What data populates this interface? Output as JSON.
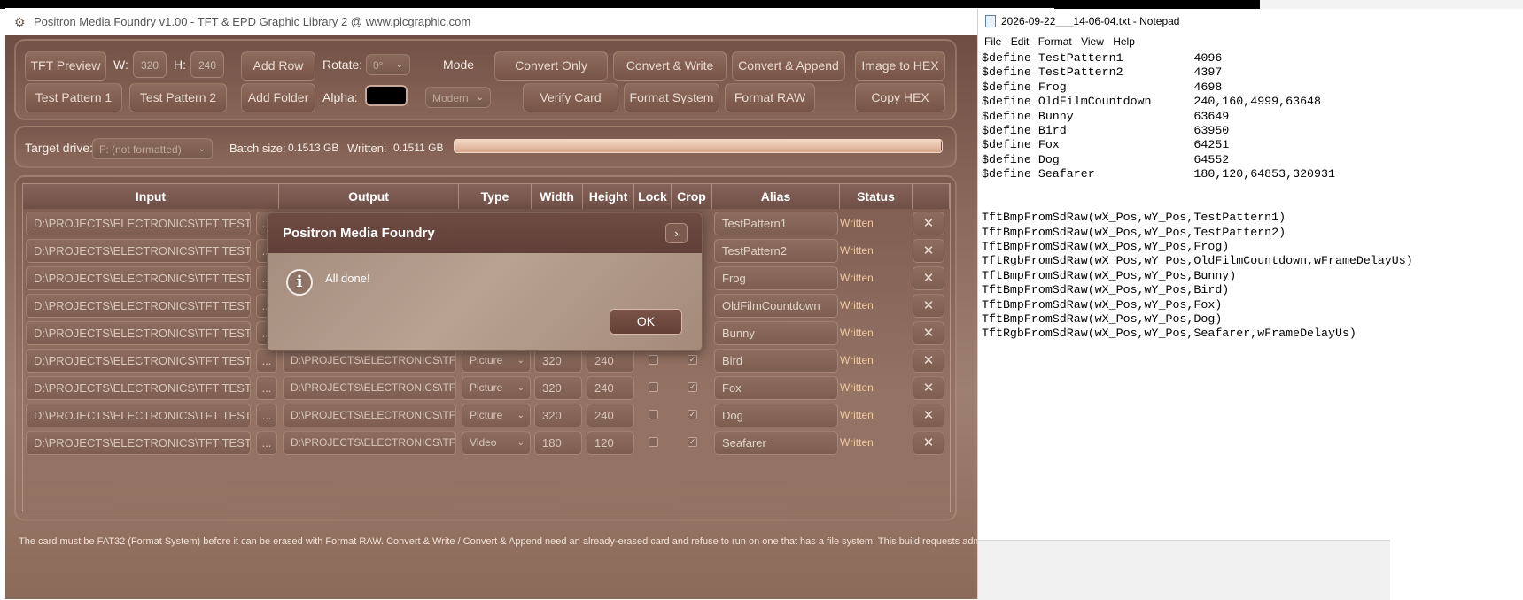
{
  "app": {
    "title": "Positron Media Foundry v1.00 - TFT & EPD Graphic Library 2 @ www.picgraphic.com",
    "toolbar": {
      "tft_preview": "TFT Preview",
      "w_label": "W:",
      "w_value": "320",
      "h_label": "H:",
      "h_value": "240",
      "add_row": "Add Row",
      "rotate_label": "Rotate:",
      "rotate_value": "0°",
      "mode_label": "Mode",
      "convert_only": "Convert Only",
      "convert_write": "Convert & Write",
      "convert_append": "Convert & Append",
      "image_to_hex": "Image to HEX",
      "test_pattern_1": "Test Pattern 1",
      "test_pattern_2": "Test Pattern 2",
      "add_folder": "Add Folder",
      "alpha_label": "Alpha:",
      "alpha_color": "#000000",
      "mode_value": "Modern",
      "verify_card": "Verify Card",
      "format_system": "Format System",
      "format_raw": "Format RAW",
      "copy_hex": "Copy HEX"
    },
    "drive": {
      "target_label": "Target drive:",
      "target_value": "F: (not formatted)",
      "batch_label": "Batch size:",
      "batch_value": "0.1513 GB",
      "written_label": "Written:",
      "written_value": "0.1511 GB",
      "progress_percent": 99.9
    },
    "grid": {
      "columns": [
        "Input",
        "Output",
        "Type",
        "Width",
        "Height",
        "Lock",
        "Crop",
        "Alias",
        "Status"
      ],
      "rows": [
        {
          "input": "D:\\PROJECTS\\ELECTRONICS\\TFT TEST BOARD\\",
          "output": "",
          "type": "",
          "width": "",
          "height": "",
          "lock": false,
          "crop": false,
          "alias": "TestPattern1",
          "status": "Written"
        },
        {
          "input": "D:\\PROJECTS\\ELECTRONICS\\TFT TEST BOARD\\",
          "output": "",
          "type": "",
          "width": "",
          "height": "",
          "lock": false,
          "crop": false,
          "alias": "TestPattern2",
          "status": "Written"
        },
        {
          "input": "D:\\PROJECTS\\ELECTRONICS\\TFT TEST BOARD\\",
          "output": "",
          "type": "",
          "width": "",
          "height": "",
          "lock": false,
          "crop": false,
          "alias": "Frog",
          "status": "Written"
        },
        {
          "input": "D:\\PROJECTS\\ELECTRONICS\\TFT TEST BOARD\\",
          "output": "",
          "type": "",
          "width": "",
          "height": "",
          "lock": false,
          "crop": false,
          "alias": "OldFilmCountdown",
          "status": "Written"
        },
        {
          "input": "D:\\PROJECTS\\ELECTRONICS\\TFT TEST BOARD\\",
          "output": "",
          "type": "",
          "width": "",
          "height": "",
          "lock": false,
          "crop": false,
          "alias": "Bunny",
          "status": "Written"
        },
        {
          "input": "D:\\PROJECTS\\ELECTRONICS\\TFT TEST BOARD\\",
          "output": "D:\\PROJECTS\\ELECTRONICS\\TFT TE",
          "type": "Picture",
          "width": "320",
          "height": "240",
          "lock": false,
          "crop": true,
          "alias": "Bird",
          "status": "Written"
        },
        {
          "input": "D:\\PROJECTS\\ELECTRONICS\\TFT TEST BOARD\\",
          "output": "D:\\PROJECTS\\ELECTRONICS\\TFT TE",
          "type": "Picture",
          "width": "320",
          "height": "240",
          "lock": false,
          "crop": true,
          "alias": "Fox",
          "status": "Written"
        },
        {
          "input": "D:\\PROJECTS\\ELECTRONICS\\TFT TEST BOARD\\",
          "output": "D:\\PROJECTS\\ELECTRONICS\\TFT TE",
          "type": "Picture",
          "width": "320",
          "height": "240",
          "lock": false,
          "crop": true,
          "alias": "Dog",
          "status": "Written"
        },
        {
          "input": "D:\\PROJECTS\\ELECTRONICS\\TFT TEST BOARD\\",
          "output": "D:\\PROJECTS\\ELECTRONICS\\TFT TE",
          "type": "Video",
          "width": "180",
          "height": "120",
          "lock": false,
          "crop": true,
          "alias": "Seafarer",
          "status": "Written"
        }
      ],
      "browse_label": "...",
      "remove_glyph": "✕"
    },
    "footer": "The card must be FAT32 (Format System) before it can be erased with Format RAW. Convert & Write / Convert & Append need an already-erased card and refuse to run on one that has a file system. This build requests administrator rights."
  },
  "dialog": {
    "title": "Positron Media Foundry",
    "collapse_glyph": "›",
    "info_glyph": "i",
    "message": "All done!",
    "ok": "OK"
  },
  "notepad": {
    "title": "2026-09-22___14-06-04.txt - Notepad",
    "menu": [
      "File",
      "Edit",
      "Format",
      "View",
      "Help"
    ],
    "lines": [
      "$define TestPattern1          4096",
      "$define TestPattern2          4397",
      "$define Frog                  4698",
      "$define OldFilmCountdown      240,160,4999,63648",
      "$define Bunny                 63649",
      "$define Bird                  63950",
      "$define Fox                   64251",
      "$define Dog                   64552",
      "$define Seafarer              180,120,64853,320931",
      "",
      "",
      "TftBmpFromSdRaw(wX_Pos,wY_Pos,TestPattern1)",
      "TftBmpFromSdRaw(wX_Pos,wY_Pos,TestPattern2)",
      "TftBmpFromSdRaw(wX_Pos,wY_Pos,Frog)",
      "TftRgbFromSdRaw(wX_Pos,wY_Pos,OldFilmCountdown,wFrameDelayUs)",
      "TftBmpFromSdRaw(wX_Pos,wY_Pos,Bunny)",
      "TftBmpFromSdRaw(wX_Pos,wY_Pos,Bird)",
      "TftBmpFromSdRaw(wX_Pos,wY_Pos,Fox)",
      "TftBmpFromSdRaw(wX_Pos,wY_Pos,Dog)",
      "TftRgbFromSdRaw(wX_Pos,wY_Pos,Seafarer,wFrameDelayUs)"
    ]
  }
}
